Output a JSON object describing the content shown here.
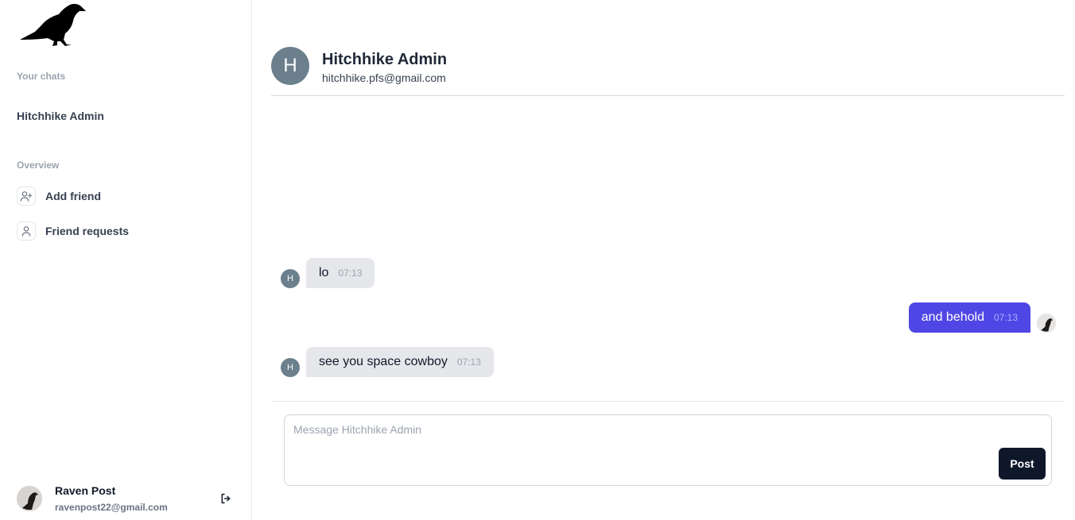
{
  "sidebar": {
    "logo_icon": "raven-logo",
    "chats_label": "Your chats",
    "chats": [
      {
        "label": "Hitchhike Admin"
      }
    ],
    "overview_label": "Overview",
    "nav": [
      {
        "label": "Add friend",
        "icon": "user-plus-icon"
      },
      {
        "label": "Friend requests",
        "icon": "user-icon"
      }
    ],
    "profile": {
      "name": "Raven Post",
      "email": "ravenpost22@gmail.com"
    },
    "logout_icon": "logout-icon"
  },
  "chat": {
    "partner": {
      "initial": "H",
      "name": "Hitchhike Admin",
      "email": "hitchhike.pfs@gmail.com"
    },
    "messages": [
      {
        "from": "partner",
        "text": "lo",
        "time": "07:13"
      },
      {
        "from": "self",
        "text": "and behold",
        "time": "07:13"
      },
      {
        "from": "partner",
        "text": "see you space cowboy",
        "time": "07:13"
      }
    ],
    "composer": {
      "placeholder": "Message Hitchhike Admin",
      "value": "",
      "send_label": "Post"
    }
  },
  "colors": {
    "accent": "#4f46e5",
    "incoming_bubble": "#e5e7eb",
    "avatar_bg": "#6b7f8c",
    "button": "#0f172a"
  }
}
